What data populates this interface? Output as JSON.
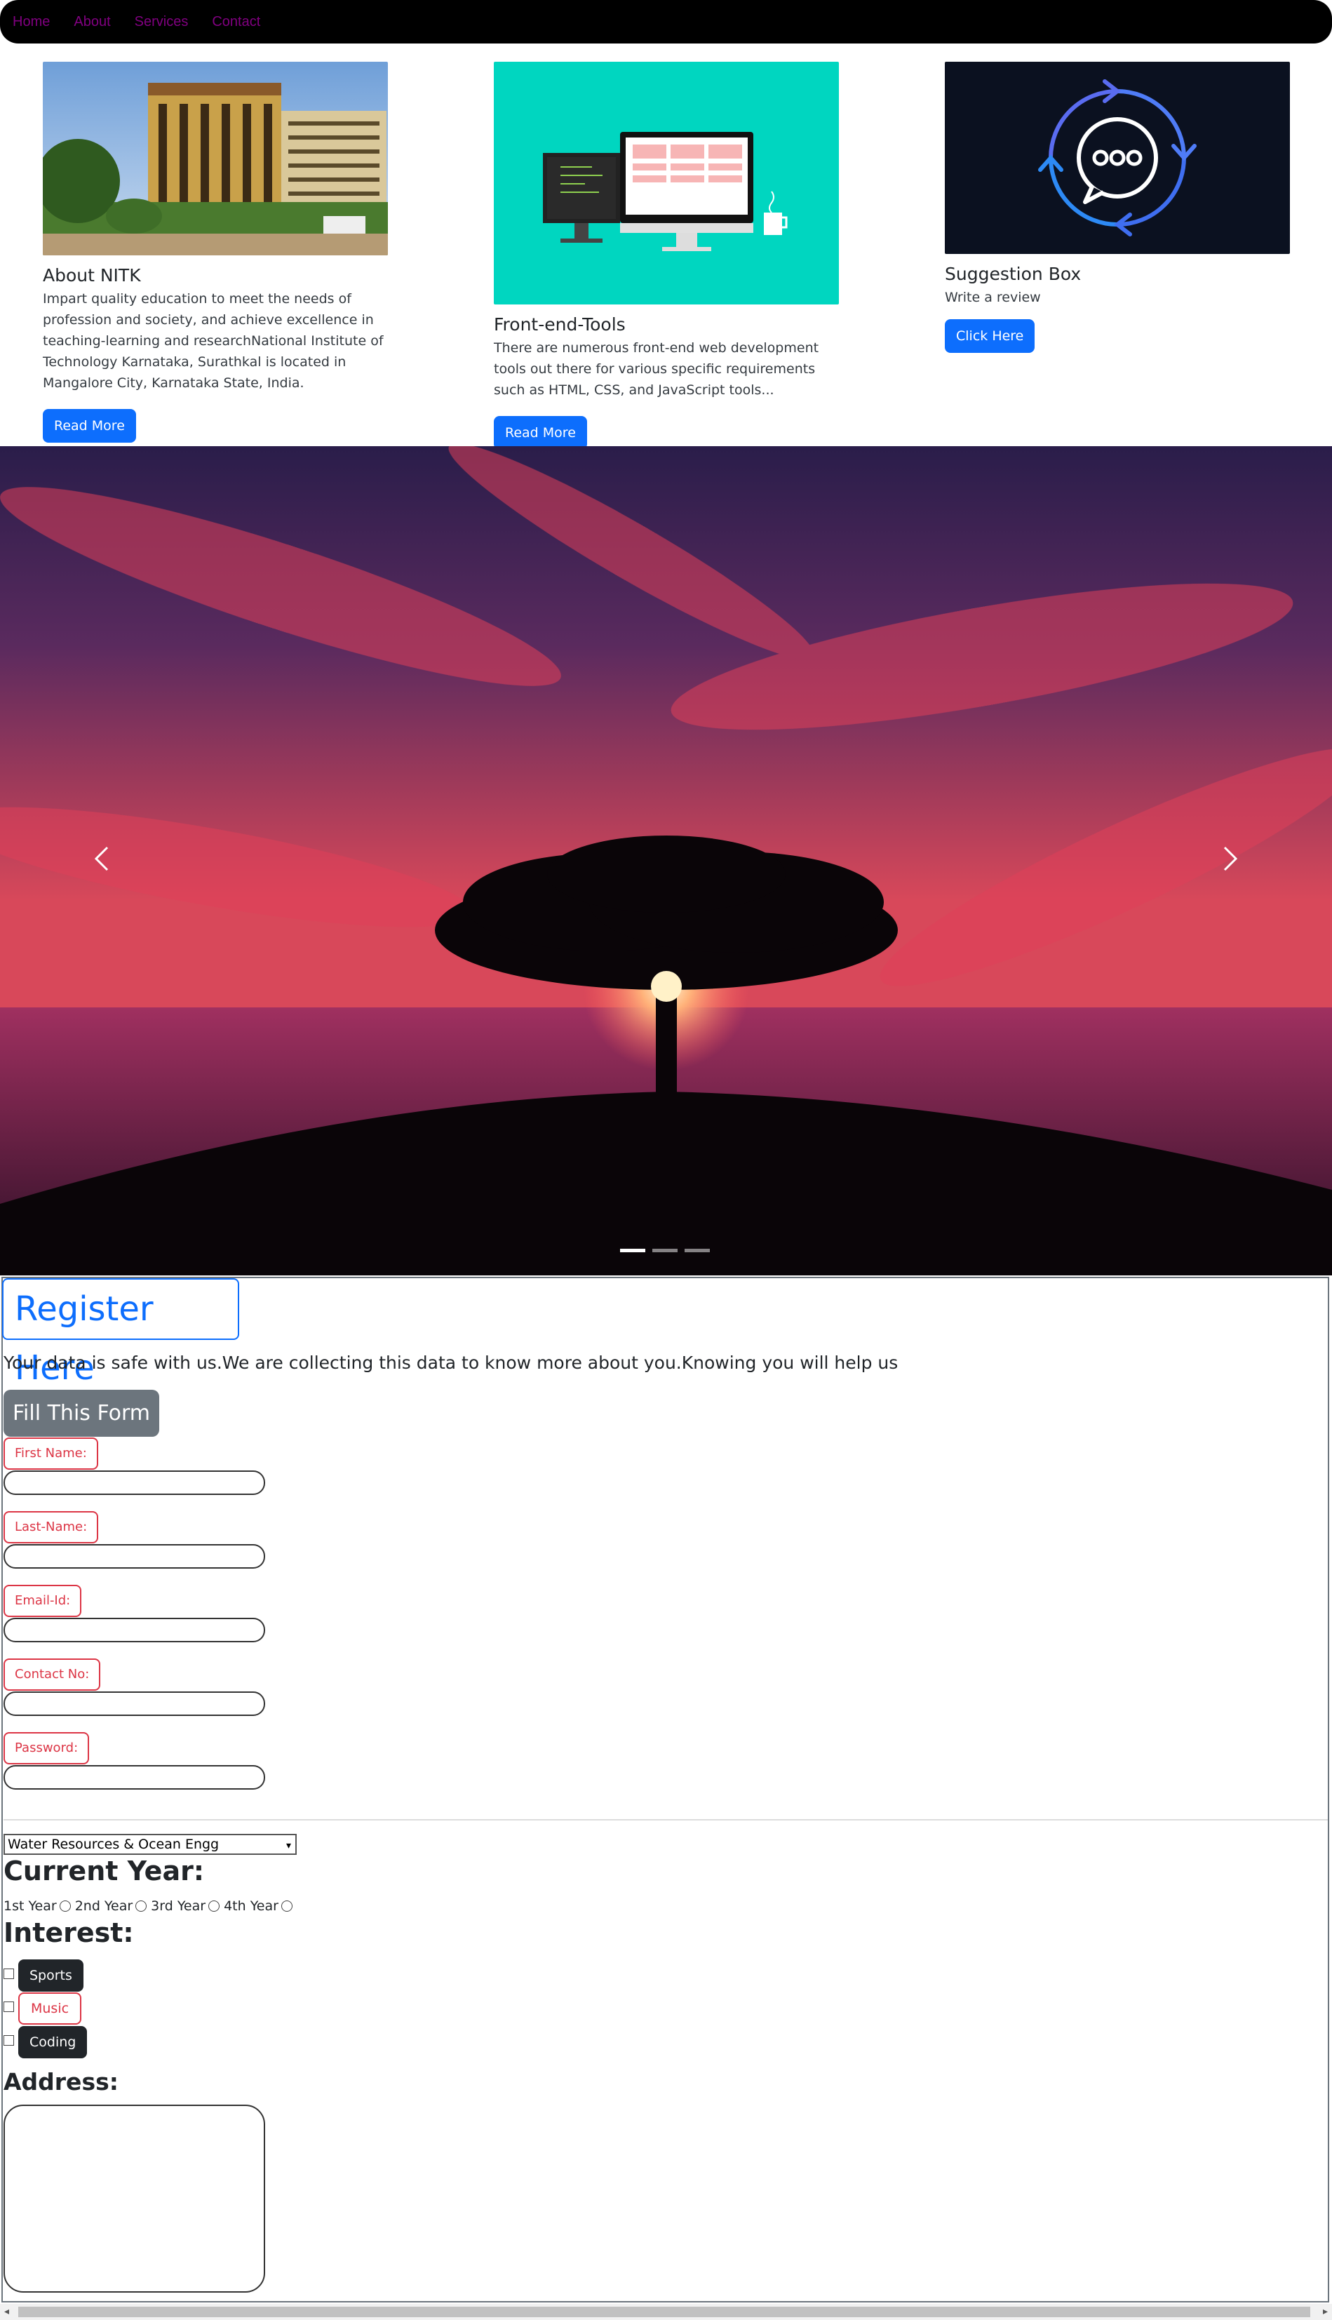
{
  "nav": {
    "items": [
      "Home",
      "About",
      "Services",
      "Contact"
    ]
  },
  "cards": [
    {
      "title": "About NITK",
      "text": "Impart quality education to meet the needs of profession and society, and achieve excellence in teaching-learning and researchNational Institute of Technology Karnataka, Surathkal is located in Mangalore City, Karnataka State, India.",
      "button": "Read More"
    },
    {
      "title": "Front-end-Tools",
      "text": "There are numerous front-end web development tools out there for various specific requirements such as HTML, CSS, and JavaScript tools...",
      "button": "Read More"
    },
    {
      "title": "Suggestion Box",
      "text": "Write a review",
      "button": "Click Here"
    }
  ],
  "carousel": {
    "prev_icon": "chevron-left-icon",
    "next_icon": "chevron-right-icon",
    "active_indicator": 1,
    "indicator_count": 3
  },
  "form": {
    "title": "Register Here",
    "lead": "Your data is safe with us.We are collecting this data to know more about you.Knowing you will help us",
    "fill_button": "Fill This Form",
    "fields": [
      {
        "label": "First Name:",
        "value": ""
      },
      {
        "label": "Last-Name:",
        "value": ""
      },
      {
        "label": "Email-Id:",
        "value": ""
      },
      {
        "label": "Contact No:",
        "value": ""
      },
      {
        "label": "Password:",
        "value": ""
      }
    ],
    "department": "Water Resources & Ocean Engg",
    "year_heading": "Current Year:",
    "years": [
      "1st Year",
      "2nd Year",
      "3rd Year",
      "4th Year"
    ],
    "interest_heading": "Interest:",
    "interests": [
      "Sports",
      "Music",
      "Coding"
    ],
    "address_heading": "Address:",
    "address_value": ""
  },
  "colors": {
    "primary": "#0d6efd",
    "danger": "#dc3545",
    "secondary": "#6c757d",
    "dark": "#212529",
    "nav_link": "#800080"
  }
}
